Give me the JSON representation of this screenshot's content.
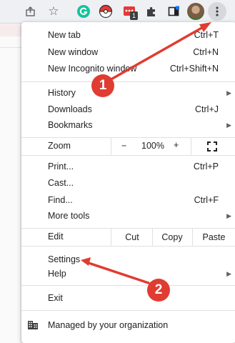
{
  "toolbar": {
    "icons": [
      "share-icon",
      "star-icon",
      "grammarly-icon",
      "pokeball-icon",
      "extension-icon",
      "puzzle-icon",
      "side-panel-icon",
      "profile-avatar",
      "more-menu-icon"
    ],
    "extension_badge": "1"
  },
  "menu": {
    "new_tab": {
      "label": "New tab",
      "shortcut": "Ctrl+T"
    },
    "new_window": {
      "label": "New window",
      "shortcut": "Ctrl+N"
    },
    "new_incognito": {
      "label": "New Incognito window",
      "shortcut": "Ctrl+Shift+N"
    },
    "history": {
      "label": "History"
    },
    "downloads": {
      "label": "Downloads",
      "shortcut": "Ctrl+J"
    },
    "bookmarks": {
      "label": "Bookmarks"
    },
    "zoom": {
      "label": "Zoom",
      "minus": "−",
      "level": "100%",
      "plus": "+"
    },
    "print": {
      "label": "Print...",
      "shortcut": "Ctrl+P"
    },
    "cast": {
      "label": "Cast..."
    },
    "find": {
      "label": "Find...",
      "shortcut": "Ctrl+F"
    },
    "more_tools": {
      "label": "More tools"
    },
    "edit": {
      "label": "Edit",
      "cut": "Cut",
      "copy": "Copy",
      "paste": "Paste"
    },
    "settings": {
      "label": "Settings"
    },
    "help": {
      "label": "Help"
    },
    "exit": {
      "label": "Exit"
    },
    "managed": {
      "label": "Managed by your organization"
    }
  },
  "annotations": [
    {
      "number": "1",
      "color": "#e03c31"
    },
    {
      "number": "2",
      "color": "#e03c31"
    }
  ]
}
